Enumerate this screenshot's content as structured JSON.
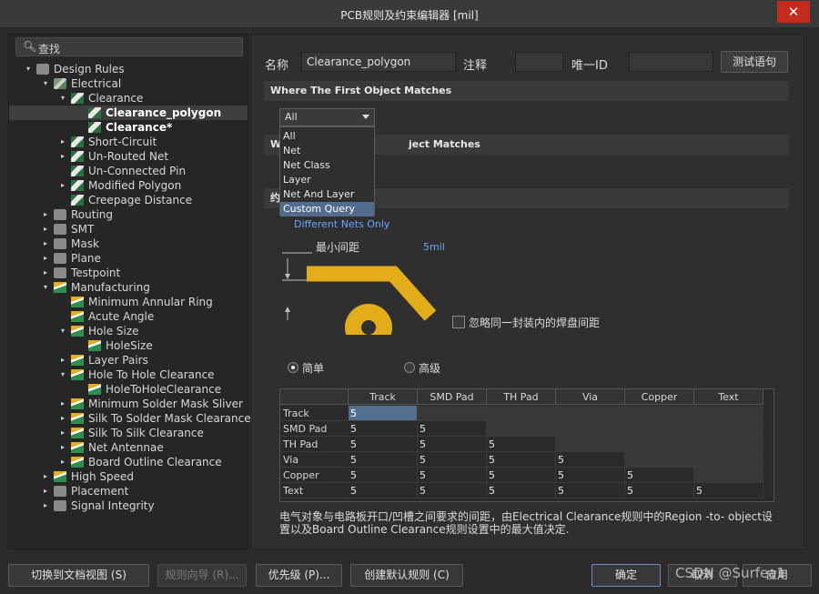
{
  "window": {
    "title": "PCB规则及约束编辑器 [mil]",
    "close": "✕"
  },
  "search": {
    "label": "查找",
    "icon": "search-icon"
  },
  "tree": [
    {
      "label": "Design Rules",
      "indent": 0,
      "arrow": "▾",
      "icon": "design-rules-icon",
      "style": "gray"
    },
    {
      "label": "Electrical",
      "indent": 1,
      "arrow": "▾",
      "icon": "electrical-icon",
      "style": "el"
    },
    {
      "label": "Clearance",
      "indent": 2,
      "arrow": "▾",
      "icon": "rule-icon",
      "style": "rule"
    },
    {
      "label": "Clearance_polygon",
      "indent": 3,
      "arrow": "",
      "icon": "rule-icon",
      "style": "rule",
      "bold": true,
      "selected": true
    },
    {
      "label": "Clearance*",
      "indent": 3,
      "arrow": "",
      "icon": "rule-icon",
      "style": "rule",
      "bold": true
    },
    {
      "label": "Short-Circuit",
      "indent": 2,
      "arrow": "▸",
      "icon": "rule-icon",
      "style": "rule"
    },
    {
      "label": "Un-Routed Net",
      "indent": 2,
      "arrow": "▸",
      "icon": "rule-icon",
      "style": "rule"
    },
    {
      "label": "Un-Connected Pin",
      "indent": 2,
      "arrow": "",
      "icon": "rule-icon",
      "style": "rule"
    },
    {
      "label": "Modified Polygon",
      "indent": 2,
      "arrow": "▸",
      "icon": "rule-icon",
      "style": "rule"
    },
    {
      "label": "Creepage Distance",
      "indent": 2,
      "arrow": "",
      "icon": "rule-icon",
      "style": "rule"
    },
    {
      "label": "Routing",
      "indent": 1,
      "arrow": "▸",
      "icon": "routing-icon",
      "style": "gray"
    },
    {
      "label": "SMT",
      "indent": 1,
      "arrow": "▸",
      "icon": "smt-icon",
      "style": "gray"
    },
    {
      "label": "Mask",
      "indent": 1,
      "arrow": "▸",
      "icon": "mask-icon",
      "style": "gray"
    },
    {
      "label": "Plane",
      "indent": 1,
      "arrow": "▸",
      "icon": "plane-icon",
      "style": "gray"
    },
    {
      "label": "Testpoint",
      "indent": 1,
      "arrow": "▸",
      "icon": "testpoint-icon",
      "style": "gray"
    },
    {
      "label": "Manufacturing",
      "indent": 1,
      "arrow": "▾",
      "icon": "manufacturing-icon",
      "style": "mfg"
    },
    {
      "label": "Minimum Annular Ring",
      "indent": 2,
      "arrow": "",
      "icon": "mfg-rule-icon",
      "style": "mfg"
    },
    {
      "label": "Acute Angle",
      "indent": 2,
      "arrow": "",
      "icon": "mfg-rule-icon",
      "style": "mfg"
    },
    {
      "label": "Hole Size",
      "indent": 2,
      "arrow": "▾",
      "icon": "mfg-rule-icon",
      "style": "mfg"
    },
    {
      "label": "HoleSize",
      "indent": 3,
      "arrow": "",
      "icon": "mfg-rule-icon",
      "style": "mfg"
    },
    {
      "label": "Layer Pairs",
      "indent": 2,
      "arrow": "▸",
      "icon": "mfg-rule-icon",
      "style": "mfg"
    },
    {
      "label": "Hole To Hole Clearance",
      "indent": 2,
      "arrow": "▾",
      "icon": "mfg-rule-icon",
      "style": "mfg"
    },
    {
      "label": "HoleToHoleClearance",
      "indent": 3,
      "arrow": "",
      "icon": "mfg-rule-icon",
      "style": "mfg"
    },
    {
      "label": "Minimum Solder Mask Sliver",
      "indent": 2,
      "arrow": "▸",
      "icon": "mfg-rule-icon",
      "style": "mfg"
    },
    {
      "label": "Silk To Solder Mask Clearance",
      "indent": 2,
      "arrow": "▸",
      "icon": "mfg-rule-icon",
      "style": "mfg"
    },
    {
      "label": "Silk To Silk Clearance",
      "indent": 2,
      "arrow": "▸",
      "icon": "mfg-rule-icon",
      "style": "mfg"
    },
    {
      "label": "Net Antennae",
      "indent": 2,
      "arrow": "▸",
      "icon": "mfg-rule-icon",
      "style": "mfg"
    },
    {
      "label": "Board Outline Clearance",
      "indent": 2,
      "arrow": "▸",
      "icon": "mfg-rule-icon",
      "style": "mfg"
    },
    {
      "label": "High Speed",
      "indent": 1,
      "arrow": "▸",
      "icon": "high-speed-icon",
      "style": "mfg"
    },
    {
      "label": "Placement",
      "indent": 1,
      "arrow": "▸",
      "icon": "placement-icon",
      "style": "gray"
    },
    {
      "label": "Signal Integrity",
      "indent": 1,
      "arrow": "▸",
      "icon": "signal-integrity-icon",
      "style": "gray"
    }
  ],
  "form": {
    "name_label": "名称",
    "name_value": "Clearance_polygon",
    "comment_label": "注释",
    "comment_value": "",
    "uid_label": "唯一ID",
    "uid_value": "",
    "test_button": "测试语句"
  },
  "sections": {
    "first": "Where The First Object Matches",
    "second_prefix": "W",
    "second_suffix": "ject Matches",
    "constraints_prefix": "约"
  },
  "scope": {
    "selected": "All",
    "options": [
      "All",
      "Net",
      "Net Class",
      "Layer",
      "Net And Layer",
      "Custom Query"
    ],
    "highlighted": "Custom Query"
  },
  "diagram": {
    "different_nets": "Different Nets Only",
    "min_clearance": "最小间距",
    "value": "5mil",
    "ignore_pads": "忽略同一封装内的焊盘间距",
    "simple": "简单",
    "advanced": "高级",
    "trace_color": "#e3ad1a"
  },
  "grid": {
    "columns": [
      "Track",
      "SMD Pad",
      "TH Pad",
      "Via",
      "Copper",
      "Text"
    ],
    "rows": [
      {
        "label": "Track",
        "values": [
          "5",
          "",
          "",
          "",
          "",
          ""
        ]
      },
      {
        "label": "SMD Pad",
        "values": [
          "5",
          "5",
          "",
          "",
          "",
          ""
        ]
      },
      {
        "label": "TH Pad",
        "values": [
          "5",
          "5",
          "5",
          "",
          "",
          ""
        ]
      },
      {
        "label": "Via",
        "values": [
          "5",
          "5",
          "5",
          "5",
          "",
          ""
        ]
      },
      {
        "label": "Copper",
        "values": [
          "5",
          "5",
          "5",
          "5",
          "5",
          ""
        ]
      },
      {
        "label": "Text",
        "values": [
          "5",
          "5",
          "5",
          "5",
          "5",
          "5"
        ]
      }
    ]
  },
  "note": "电气对象与电路板开口/凹槽之间要求的间距，由Electrical Clearance规则中的Region -to- object设置以及Board Outline Clearance规则设置中的最大值决定.",
  "bottom": {
    "doc_view": "切换到文档视图 (S)",
    "wizard": "规则向导 (R)...",
    "priority": "优先级 (P)...",
    "create_default": "创建默认规则 (C)",
    "ok": "确定",
    "cancel": "取消",
    "apply": "应用"
  },
  "watermark": "CSDN @Surfea1"
}
